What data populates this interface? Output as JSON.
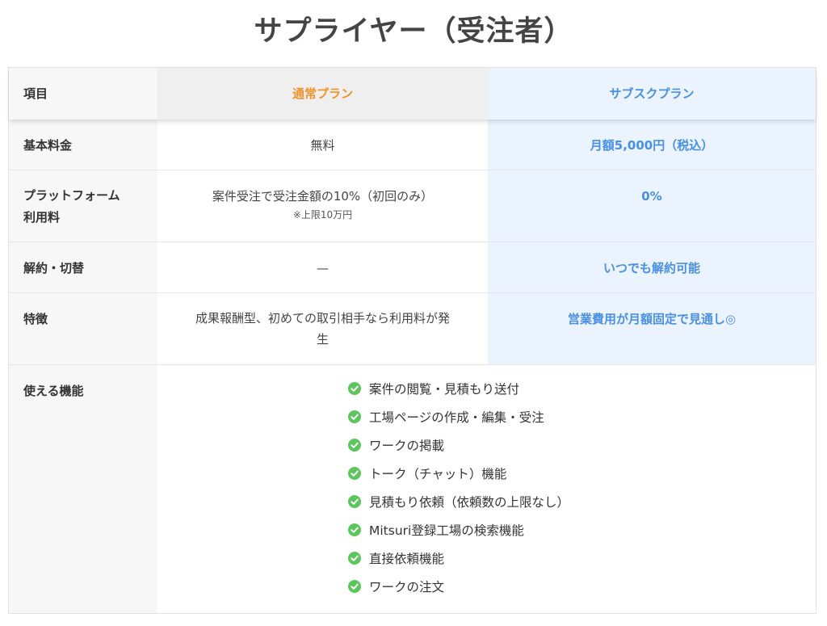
{
  "title": "サプライヤー（受注者）",
  "colors": {
    "normal_plan": "#f0922b",
    "sub_plan": "#4a90e2",
    "check": "#5cc65c"
  },
  "header": {
    "label": "項目",
    "normal": "通常プラン",
    "sub": "サブスクプラン"
  },
  "rows": [
    {
      "label": "基本料金",
      "normal": "無料",
      "sub": "月額5,000円（税込）"
    },
    {
      "label_line1": "プラットフォーム",
      "label_line2": "利用料",
      "normal": "案件受注で受注金額の10%（初回のみ）",
      "normal_note": "※上限10万円",
      "sub": "0%"
    },
    {
      "label": "解約・切替",
      "normal": "—",
      "sub": "いつでも解約可能"
    },
    {
      "label": "特徴",
      "normal_line1": "成果報酬型、初めての取引相手なら利用料が発",
      "normal_line2": "生",
      "sub": "営業費用が月額固定で見通し◎"
    }
  ],
  "features": {
    "label": "使える機能",
    "icon": "check-circle-icon",
    "items": [
      "案件の閲覧・見積もり送付",
      "工場ページの作成・編集・受注",
      "ワークの掲載",
      "トーク（チャット）機能",
      "見積もり依頼（依頼数の上限なし）",
      "Mitsuri登録工場の検索機能",
      "直接依頼機能",
      "ワークの注文"
    ]
  }
}
